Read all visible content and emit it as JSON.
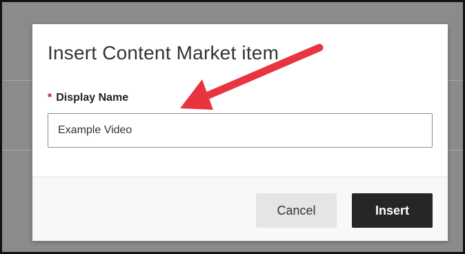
{
  "dialog": {
    "title": "Insert Content Market item",
    "field_label": "Display Name",
    "required_marker": "*",
    "display_name_value": "Example Video",
    "cancel_label": "Cancel",
    "insert_label": "Insert"
  },
  "colors": {
    "annotation_arrow": "#e8343f",
    "required_marker": "#c8102e",
    "primary_button": "#262626",
    "secondary_button": "#e5e5e5",
    "backdrop": "#8b8b8b"
  },
  "icons": {
    "annotation": "arrow-annotation-icon"
  }
}
